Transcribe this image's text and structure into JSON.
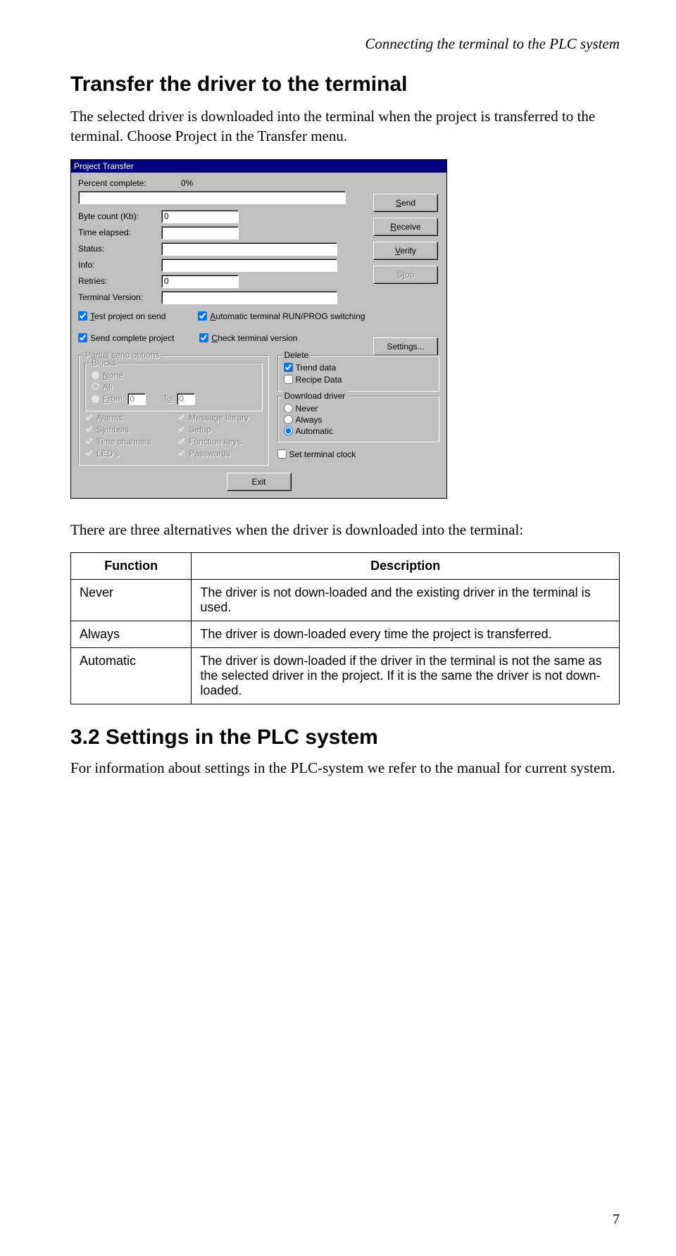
{
  "header": "Connecting the terminal to the PLC system",
  "h1": "Transfer the driver to the terminal",
  "intro": "The selected driver is downloaded into the terminal when the project is transferred to the terminal. Choose Project in the Transfer menu.",
  "dialog": {
    "title": "Project Transfer",
    "labels": {
      "percent": "Percent complete:",
      "percent_val": "0%",
      "byte": "Byte count (Kb):",
      "byte_val": "0",
      "time": "Time elapsed:",
      "status": "Status:",
      "info": "Info:",
      "retries": "Retries:",
      "retries_val": "0",
      "termver": "Terminal Version:"
    },
    "buttons": {
      "send": "Send",
      "receive": "Receive",
      "verify": "Verify",
      "stop": "Stop",
      "settings": "Settings...",
      "exit": "Exit"
    },
    "checks": {
      "test": "Test project on send",
      "auto": "Automatic terminal RUN/PROG switching",
      "sendcomplete": "Send complete project",
      "checkver": "Check terminal version"
    },
    "partial": {
      "title": "Partial send options",
      "blocks": "Blocks",
      "none": "None",
      "all": "All",
      "from": "From:",
      "from_val": "0",
      "to": "To:",
      "to_val": "0",
      "alarms": "Alarms",
      "symbols": "Symbols",
      "timech": "Time channels",
      "leds": "LED's",
      "msglib": "Message library",
      "setup": "Setup",
      "funkeys": "Function keys",
      "passwords": "Passwords"
    },
    "delete": {
      "title": "Delete",
      "trend": "Trend data",
      "recipe": "Recipe Data"
    },
    "download": {
      "title": "Download driver",
      "never": "Never",
      "always": "Always",
      "automatic": "Automatic"
    },
    "setclock": "Set terminal clock"
  },
  "after_dialog": "There are three alternatives when the driver is downloaded into the terminal:",
  "table": {
    "h1": "Function",
    "h2": "Description",
    "rows": [
      {
        "f": "Never",
        "d": "The driver is not down-loaded and the existing driver in the terminal is used."
      },
      {
        "f": "Always",
        "d": "The driver is down-loaded every time the project is transferred."
      },
      {
        "f": "Automatic",
        "d": "The driver is down-loaded if the driver in the terminal is not the same as the selected driver in the project. If it is the same the driver is not down-loaded."
      }
    ]
  },
  "h2": "3.2   Settings in the PLC system",
  "outro": "For information about settings in the PLC-system we refer to the manual for current system.",
  "pagenum": "7"
}
